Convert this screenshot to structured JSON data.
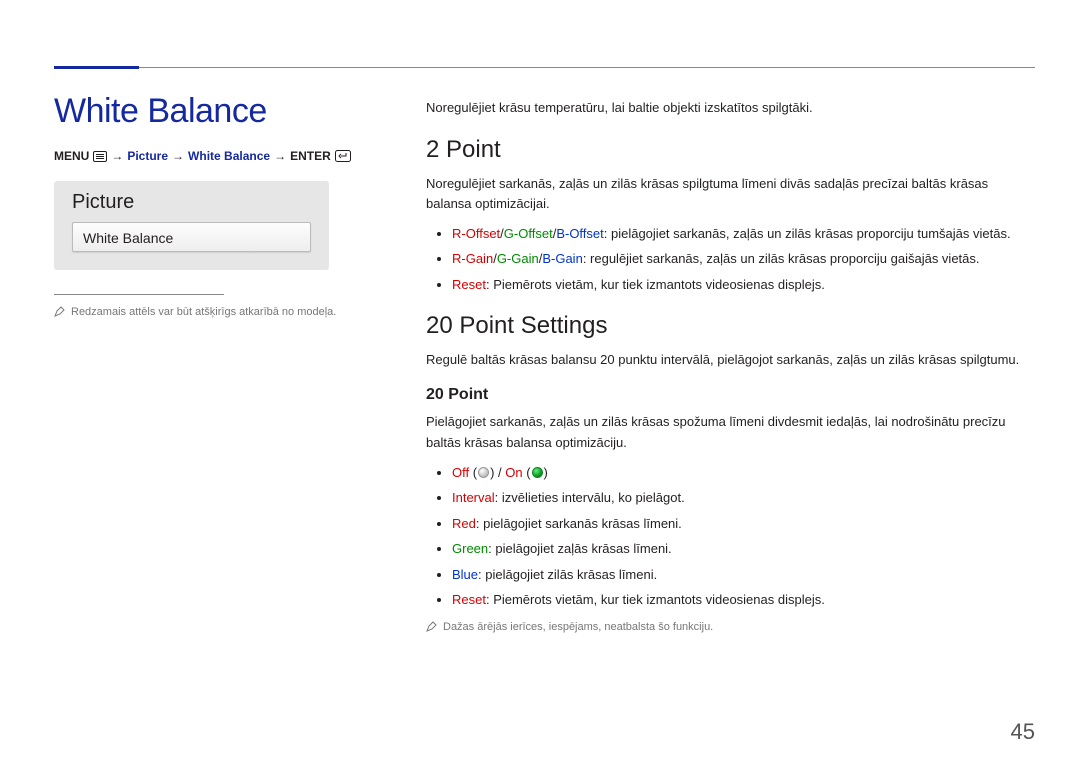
{
  "title": "White Balance",
  "breadcrumb": {
    "menu": "MENU",
    "picture": "Picture",
    "wb": "White Balance",
    "enter": "ENTER",
    "sep": "→"
  },
  "picture_box": {
    "title": "Picture",
    "item": "White Balance"
  },
  "left_note": "Redzamais attēls var būt atšķirīgs atkarībā no modeļa.",
  "intro": "Noregulējiet krāsu temperatūru, lai baltie objekti izskatītos spilgtāki.",
  "two_point": {
    "heading": "2 Point",
    "body": "Noregulējiet sarkanās, zaļās un zilās krāsas spilgtuma līmeni divās sadaļās precīzai baltās krāsas balansa optimizācijai.",
    "items": {
      "offset": {
        "r": "R-Offset",
        "g": "G-Offset",
        "b": "B-Offset",
        "rest": ": pielāgojiet sarkanās, zaļās un zilās krāsas proporciju tumšajās vietās."
      },
      "gain": {
        "r": "R-Gain",
        "g": "G-Gain",
        "b": "B-Gain",
        "rest": ": regulējiet sarkanās, zaļās un zilās krāsas proporciju gaišajās vietās."
      },
      "reset": {
        "label": "Reset",
        "rest": ": Piemērots vietām, kur tiek izmantots videosienas displejs."
      }
    }
  },
  "twenty_point": {
    "heading": "20 Point Settings",
    "body": "Regulē baltās krāsas balansu 20 punktu intervālā, pielāgojot sarkanās, zaļās un zilās krāsas spilgtumu.",
    "sub_heading": "20 Point",
    "sub_body": "Pielāgojiet sarkanās, zaļās un zilās krāsas spožuma līmeni divdesmit iedaļās, lai nodrošinātu precīzu baltās krāsas balansa optimizāciju.",
    "items": {
      "offon": {
        "off": "Off",
        "on": "On"
      },
      "interval": {
        "label": "Interval",
        "rest": ": izvēlieties intervālu, ko pielāgot."
      },
      "red": {
        "label": "Red",
        "rest": ": pielāgojiet sarkanās krāsas līmeni."
      },
      "green": {
        "label": "Green",
        "rest": ": pielāgojiet zaļās krāsas līmeni."
      },
      "blue": {
        "label": "Blue",
        "rest": ": pielāgojiet zilās krāsas līmeni."
      },
      "reset": {
        "label": "Reset",
        "rest": ": Piemērots vietām, kur tiek izmantots videosienas displejs."
      }
    },
    "note": "Dažas ārējās ierīces, iespējams, neatbalsta šo funkciju."
  },
  "page_number": "45"
}
